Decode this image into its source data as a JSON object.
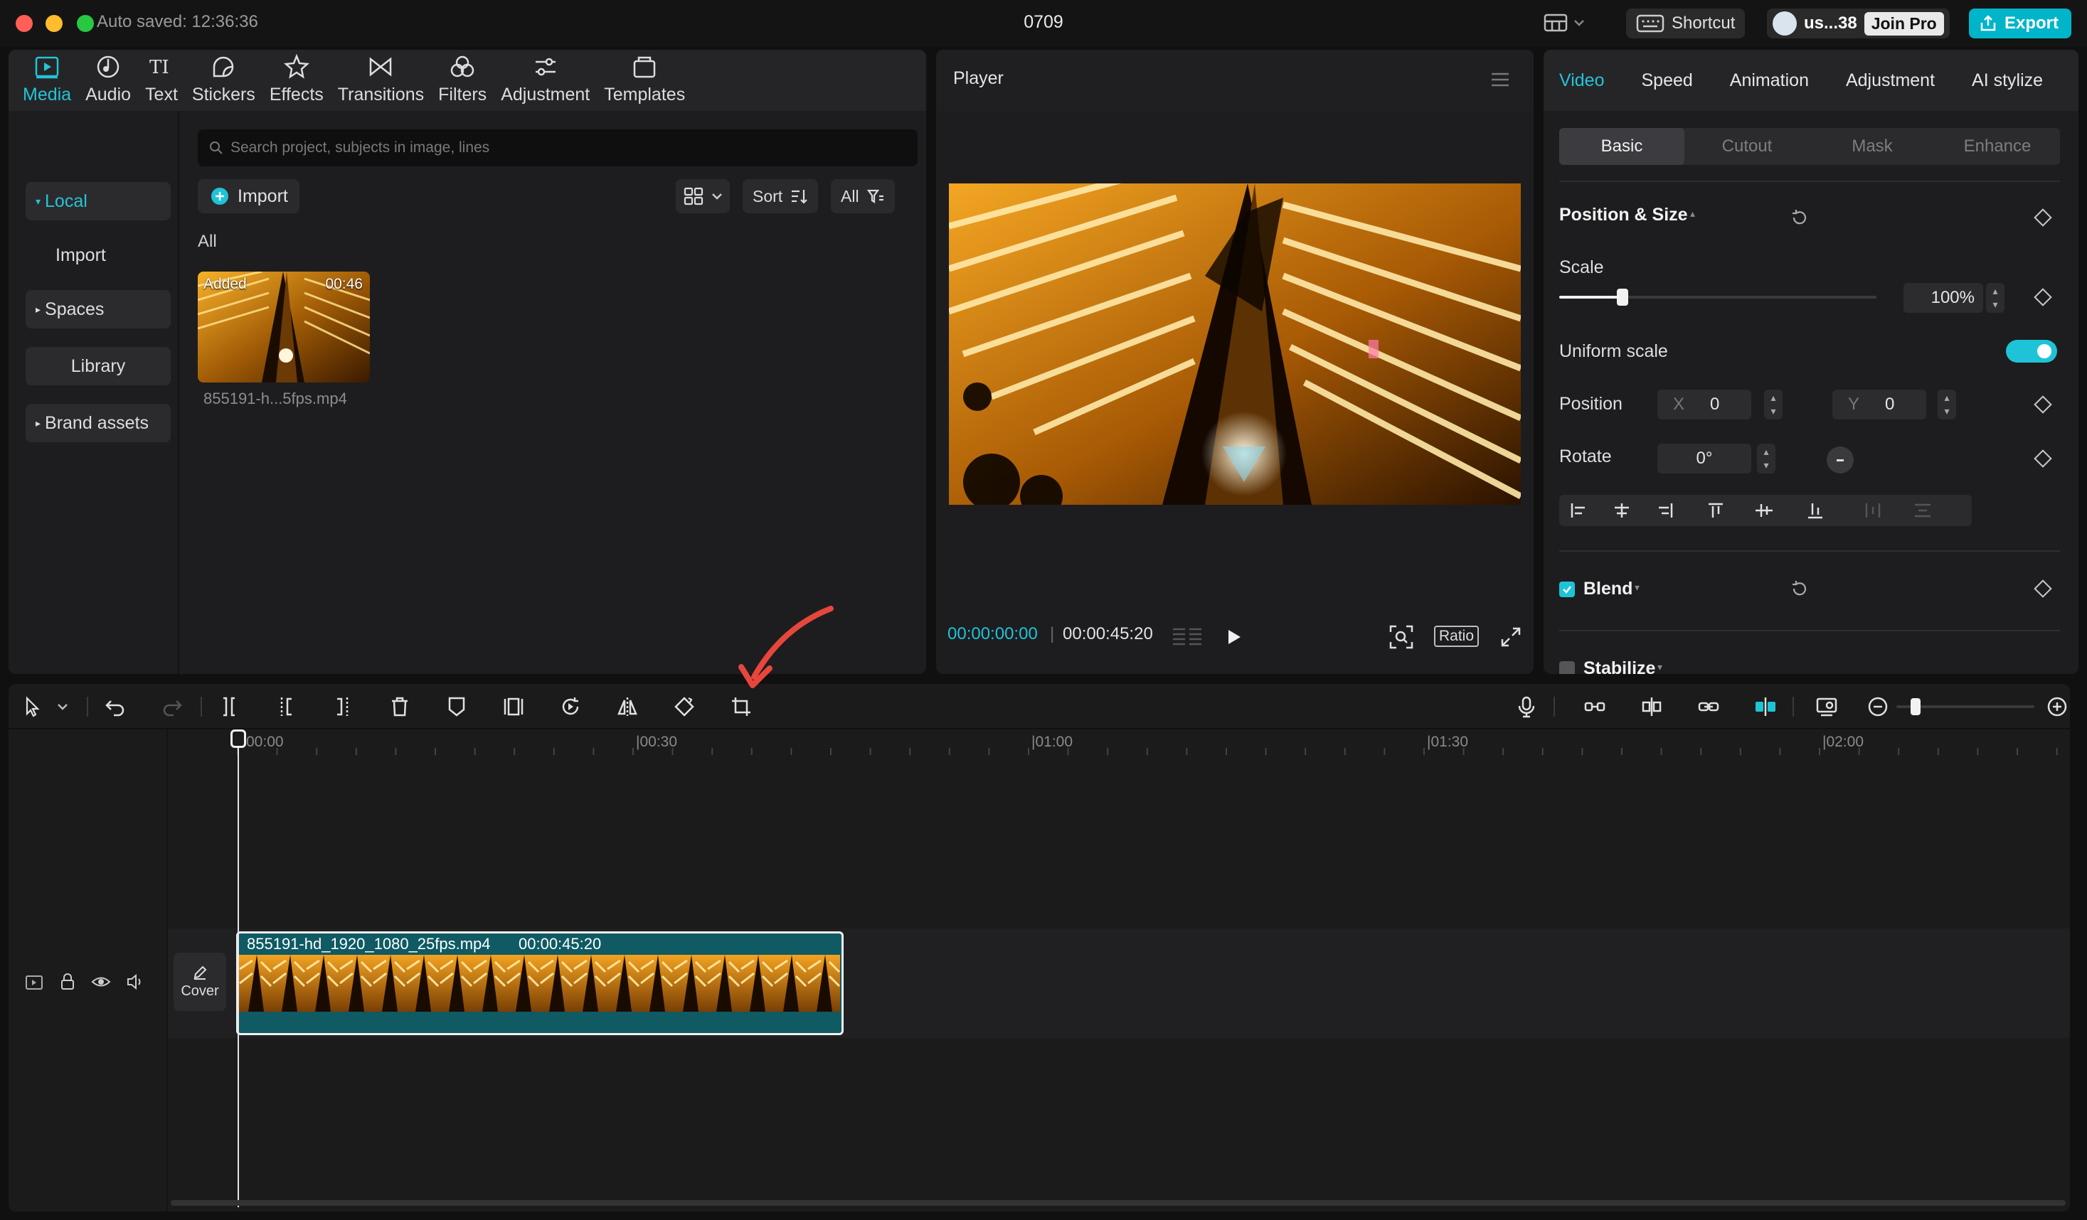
{
  "titlebar": {
    "autosave": "Auto saved: 12:36:36",
    "project": "0709",
    "shortcut": "Shortcut",
    "user": "us...38",
    "join_pro": "Join Pro",
    "export": "Export"
  },
  "media": {
    "tabs": [
      "Media",
      "Audio",
      "Text",
      "Stickers",
      "Effects",
      "Transitions",
      "Filters",
      "Adjustment",
      "Templates"
    ],
    "side": [
      "Local",
      "Import",
      "Spaces",
      "Library",
      "Brand assets"
    ],
    "search_placeholder": "Search project, subjects in image, lines",
    "import": "Import",
    "sort": "Sort",
    "all_filter": "All",
    "all_label": "All",
    "thumb": {
      "badge": "Added",
      "duration": "00:46",
      "name": "855191-h...5fps.mp4"
    }
  },
  "player": {
    "title": "Player",
    "time_current": "00:00:00:00",
    "time_sep": "|",
    "time_total": "00:00:45:20",
    "ratio": "Ratio"
  },
  "props": {
    "tabs": [
      "Video",
      "Speed",
      "Animation",
      "Adjustment",
      "AI stylize"
    ],
    "subtabs": [
      "Basic",
      "Cutout",
      "Mask",
      "Enhance"
    ],
    "section_pos": "Position & Size",
    "scale_label": "Scale",
    "scale_value": "100%",
    "scale_fraction": 0.2,
    "uniform_scale": "Uniform scale",
    "uniform_on": true,
    "position_label": "Position",
    "pos_x_label": "X",
    "pos_x": "0",
    "pos_y_label": "Y",
    "pos_y": "0",
    "rotate_label": "Rotate",
    "rotate_value": "0°",
    "blend": "Blend",
    "stabilize": "Stabilize"
  },
  "timeline": {
    "ticks": [
      "00:00",
      "|00:30",
      "|01:00",
      "|01:30",
      "|02:00"
    ],
    "cover": "Cover",
    "clip_name": "855191-hd_1920_1080_25fps.mp4",
    "clip_duration": "00:00:45:20"
  },
  "colors": {
    "accent": "#1fc3d8",
    "annotation_arrow": "#e8463c"
  }
}
